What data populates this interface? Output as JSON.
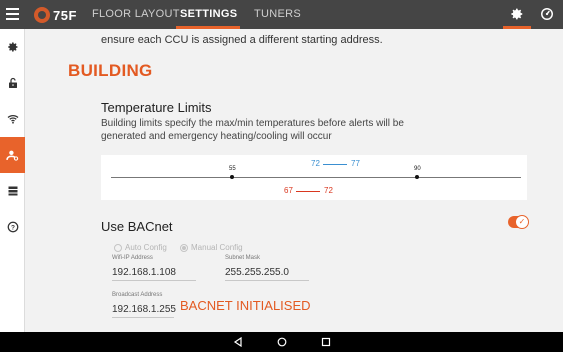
{
  "topbar": {
    "brand": "75F",
    "tabs": [
      {
        "label": "FLOOR LAYOUT",
        "active": false
      },
      {
        "label": "SETTINGS",
        "active": true
      },
      {
        "label": "TUNERS",
        "active": false
      }
    ],
    "icons": [
      "menu-icon",
      "settings-gear-icon",
      "dashboard-gauge-icon"
    ]
  },
  "sidebar": {
    "items": [
      {
        "icon": "gear-icon",
        "active": false
      },
      {
        "icon": "unlock-icon",
        "active": false
      },
      {
        "icon": "wifi-icon",
        "active": false
      },
      {
        "icon": "user-settings-icon",
        "active": true
      },
      {
        "icon": "list-icon",
        "active": false
      },
      {
        "icon": "help-icon",
        "active": false
      }
    ]
  },
  "content": {
    "intro_text": "ensure each CCU is assigned a different starting address.",
    "section_title": "BUILDING",
    "temperature_limits": {
      "title": "Temperature Limits",
      "description": "Building limits specify the max/min temperatures before alerts will be generated and emergency heating/cooling will occur",
      "building_min": "55",
      "building_max": "90",
      "cooling_min": "72",
      "cooling_max": "77",
      "heating_min": "67",
      "heating_max": "72"
    },
    "bacnet": {
      "title": "Use BACnet",
      "enabled": true,
      "radio_auto": "Auto Config",
      "radio_manual": "Manual Config",
      "wifi_ip_label": "Wifi-IP Address",
      "wifi_ip_value": "192.168.1.108",
      "subnet_label": "Subnet Mask",
      "subnet_value": "255.255.255.0",
      "broadcast_label": "Broadcast Address",
      "broadcast_value": "192.168.1.255",
      "status": "BACNET INITIALISED"
    }
  },
  "colors": {
    "accent": "#e8632b",
    "topbar": "#454545",
    "cooling": "#3a8fd1",
    "heating": "#d9371f"
  },
  "navbar": {
    "icons": [
      "back-icon",
      "home-icon",
      "recents-icon"
    ]
  }
}
